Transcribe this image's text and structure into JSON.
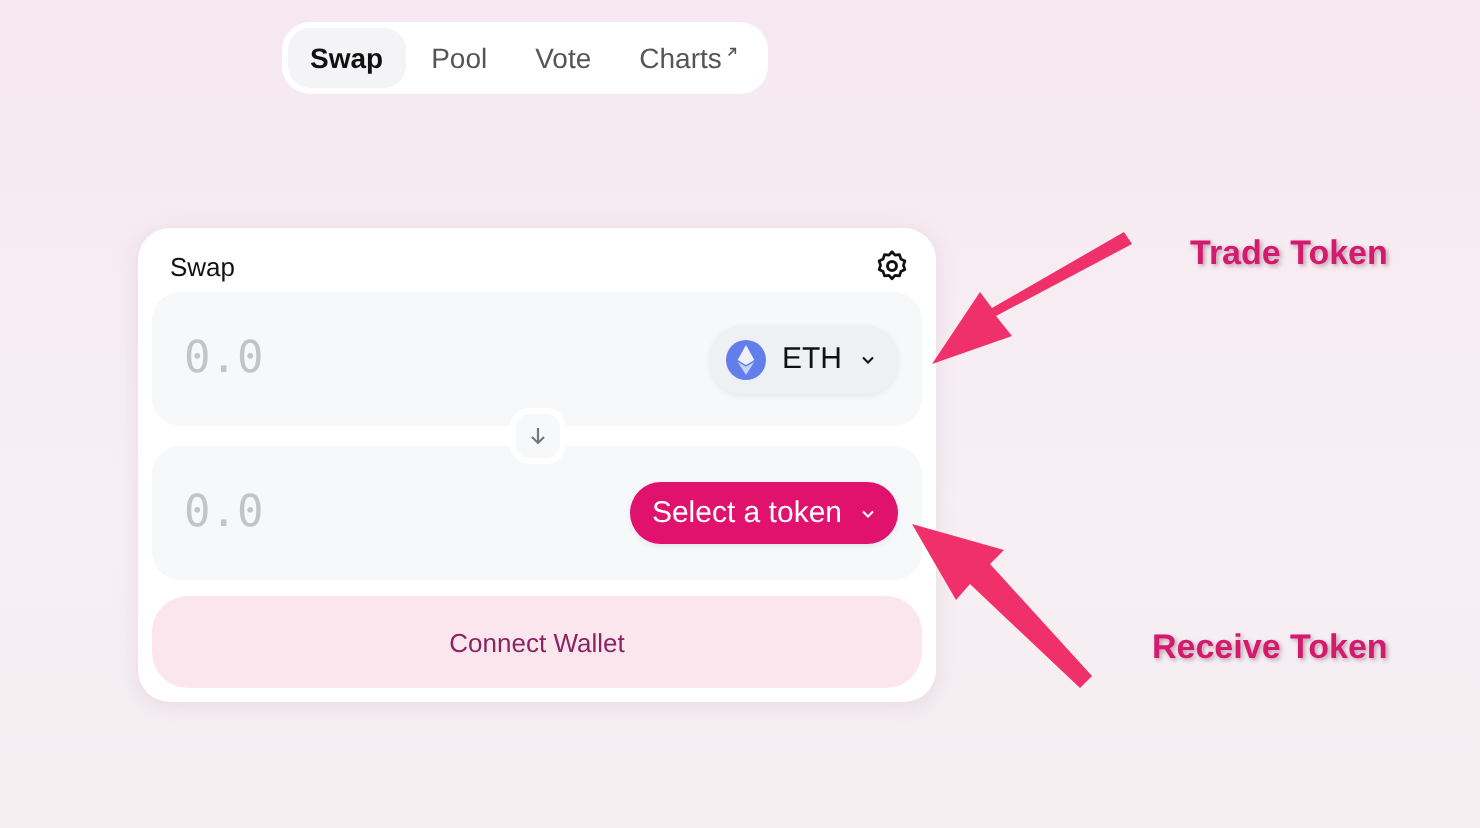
{
  "nav": {
    "tabs": [
      {
        "label": "Swap",
        "selected": true
      },
      {
        "label": "Pool",
        "selected": false
      },
      {
        "label": "Vote",
        "selected": false
      },
      {
        "label": "Charts",
        "selected": false,
        "external": true
      }
    ]
  },
  "swap": {
    "title": "Swap",
    "fields": [
      {
        "placeholder": "0.0",
        "token": {
          "kind": "token",
          "label": "ETH"
        }
      },
      {
        "placeholder": "0.0",
        "token": {
          "kind": "select",
          "label": "Select a token"
        }
      }
    ],
    "connect_button": "Connect Wallet"
  },
  "annotations": [
    {
      "label": "Trade Token"
    },
    {
      "label": "Receive Token"
    }
  ]
}
